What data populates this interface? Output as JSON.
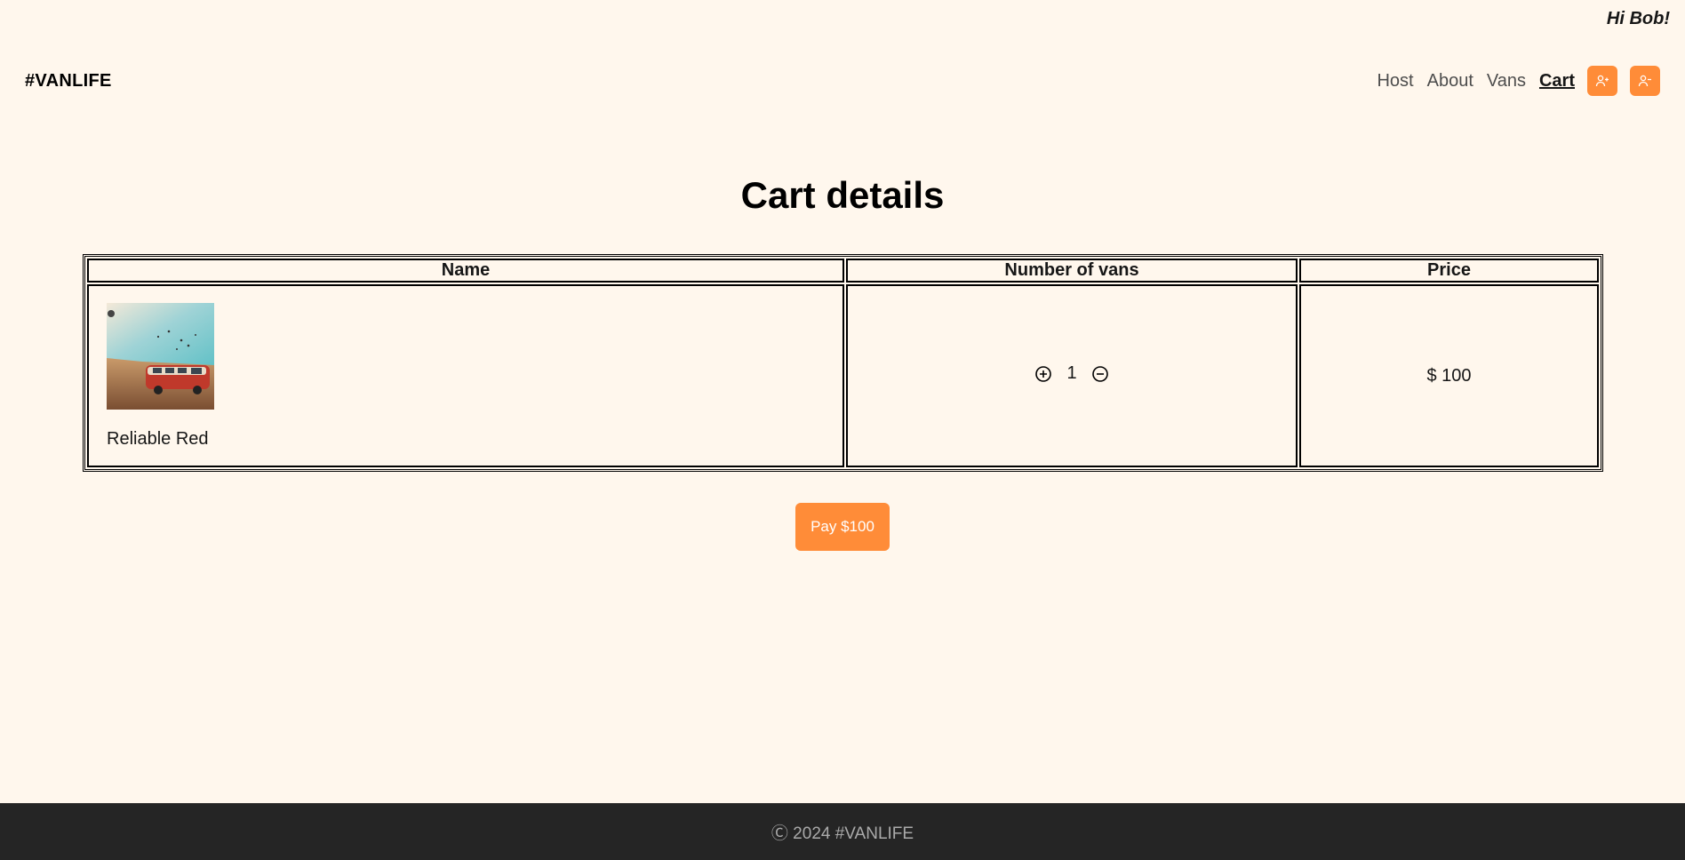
{
  "greeting": "Hi Bob!",
  "nav": {
    "logo": "#VANLIFE",
    "links": [
      {
        "label": "Host"
      },
      {
        "label": "About"
      },
      {
        "label": "Vans"
      },
      {
        "label": "Cart"
      }
    ],
    "icons": [
      "user-plus-icon",
      "user-minus-icon"
    ]
  },
  "page": {
    "title": "Cart details"
  },
  "table": {
    "headers": [
      "Name",
      "Number of vans",
      "Price"
    ],
    "rows": [
      {
        "name": "Reliable Red",
        "quantity": "1",
        "price": "$ 100"
      }
    ]
  },
  "pay_button": "Pay $100",
  "footer": "Ⓒ 2024 #VANLIFE",
  "colors": {
    "background": "#FFF7ED",
    "accent": "#FF8C38",
    "footer_bg": "#252525"
  }
}
